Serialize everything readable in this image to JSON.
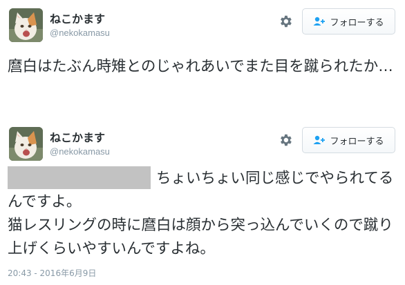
{
  "colors": {
    "text": "#292f33",
    "muted": "#8899a6",
    "follow_icon": "#1da1f2",
    "button_border": "#d4dbe1",
    "redaction": "#c2c2c2"
  },
  "tweets": [
    {
      "user": {
        "display_name": "ねこかます",
        "screen_name": "@nekokamasu",
        "avatar_icon": "cat-avatar"
      },
      "settings_icon": "gear-icon",
      "follow_button": {
        "icon": "follow-person-plus-icon",
        "label": "フォローする"
      },
      "text": "麿白はたぶん時雉とのじゃれあいでまた目を蹴られたか…"
    },
    {
      "user": {
        "display_name": "ねこかます",
        "screen_name": "@nekokamasu",
        "avatar_icon": "cat-avatar"
      },
      "settings_icon": "gear-icon",
      "follow_button": {
        "icon": "follow-person-plus-icon",
        "label": "フォローする"
      },
      "text": "ちょいちょい同じ感じでやられてるんですよ。\n猫レスリングの時に麿白は顔から突っ込んでいくので蹴り上げくらいやすいんですよね。",
      "timestamp": "20:43 - 2016年6月9日"
    }
  ]
}
